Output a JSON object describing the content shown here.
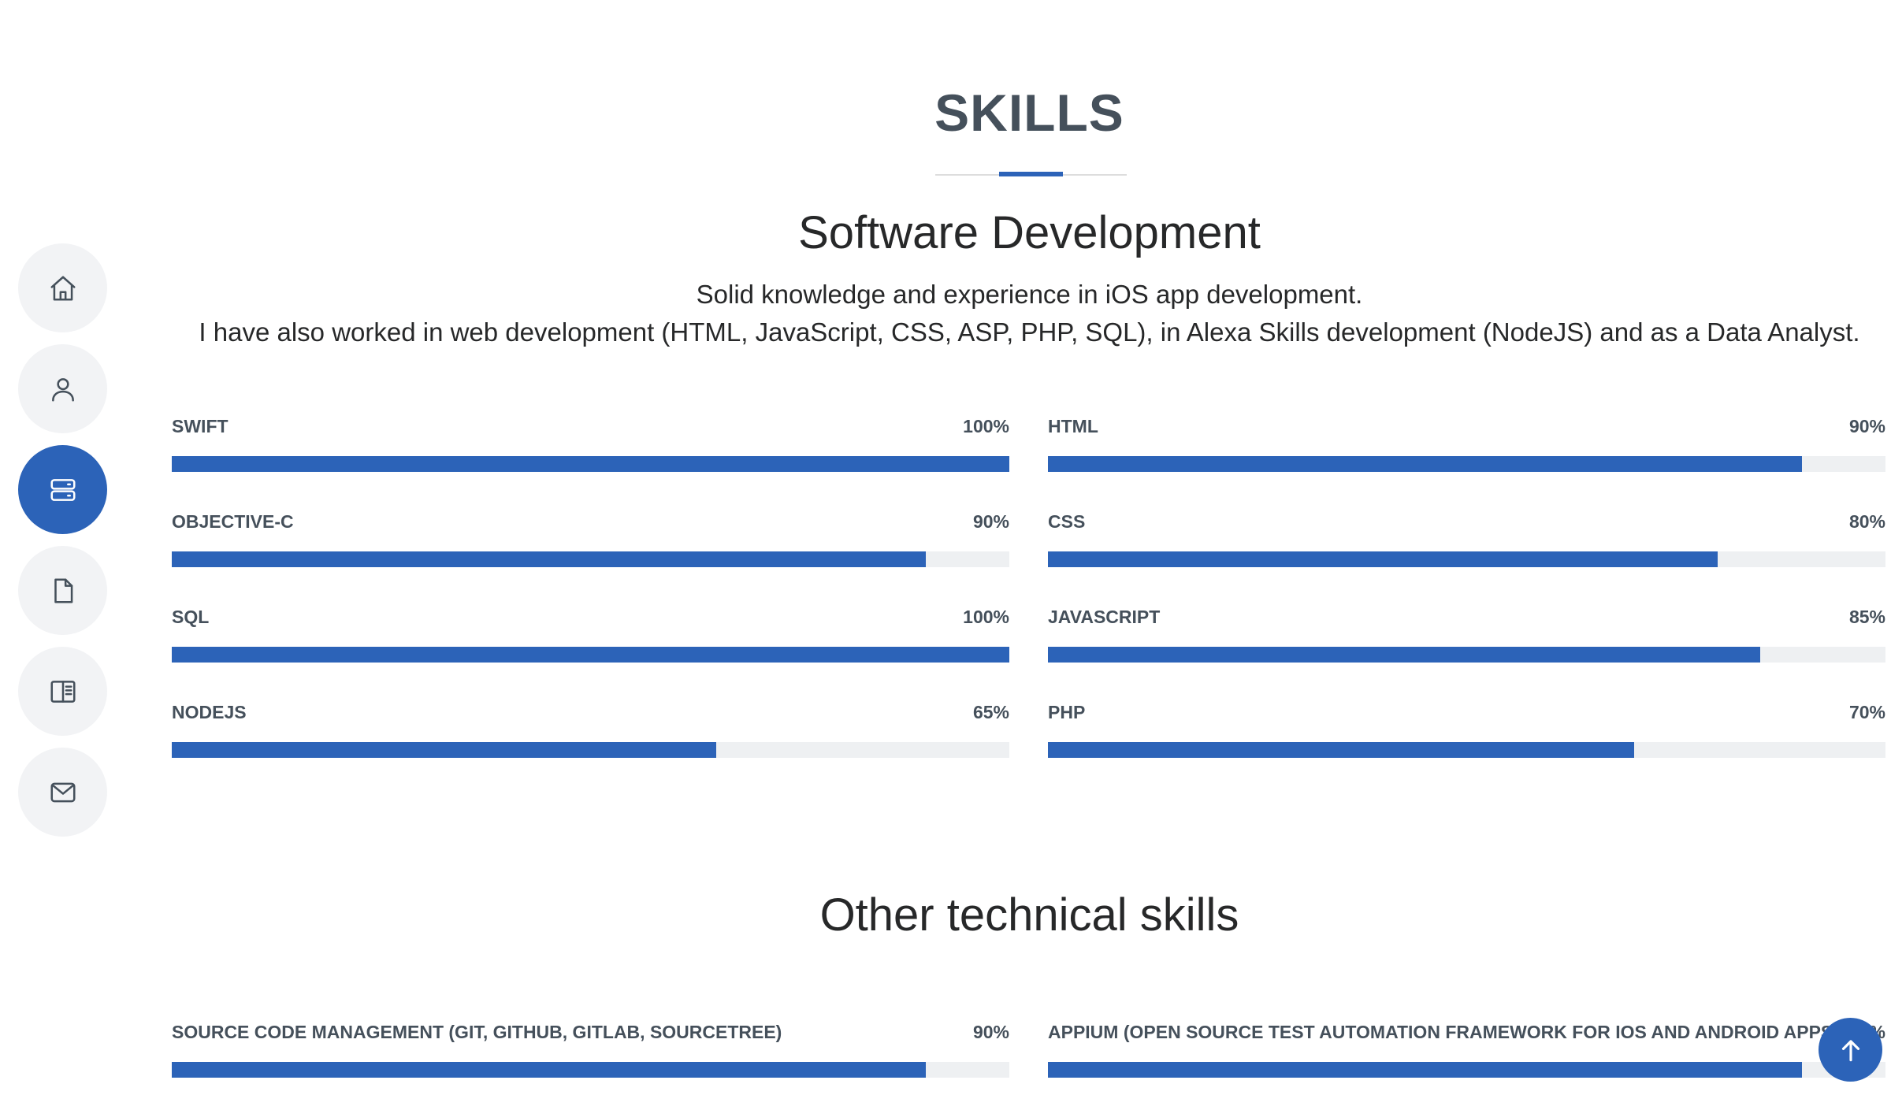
{
  "nav": [
    {
      "name": "home",
      "icon": "home-icon",
      "active": false
    },
    {
      "name": "about",
      "icon": "person-icon",
      "active": false
    },
    {
      "name": "skills",
      "icon": "server-icon",
      "active": true
    },
    {
      "name": "resume",
      "icon": "file-icon",
      "active": false
    },
    {
      "name": "portfolio",
      "icon": "book-icon",
      "active": false
    },
    {
      "name": "contact",
      "icon": "envelope-icon",
      "active": false
    }
  ],
  "section": {
    "title": "SKILLS"
  },
  "software": {
    "heading": "Software Development",
    "line1": "Solid knowledge and experience in iOS app development.",
    "line2": "I have also worked in web development (HTML, JavaScript, CSS, ASP, PHP, SQL), in Alexa Skills development (NodeJS) and as a Data Analyst.",
    "left": [
      {
        "name": "SWIFT",
        "pct": "100%",
        "value": 100
      },
      {
        "name": "OBJECTIVE-C",
        "pct": "90%",
        "value": 90
      },
      {
        "name": "SQL",
        "pct": "100%",
        "value": 100
      },
      {
        "name": "NODEJS",
        "pct": "65%",
        "value": 65
      }
    ],
    "right": [
      {
        "name": "HTML",
        "pct": "90%",
        "value": 90
      },
      {
        "name": "CSS",
        "pct": "80%",
        "value": 80
      },
      {
        "name": "JAVASCRIPT",
        "pct": "85%",
        "value": 85
      },
      {
        "name": "PHP",
        "pct": "70%",
        "value": 70
      }
    ]
  },
  "other": {
    "heading": "Other technical skills",
    "left": [
      {
        "name": "SOURCE CODE MANAGEMENT (GIT, GITHUB, GITLAB, SOURCETREE)",
        "pct": "90%",
        "value": 90
      }
    ],
    "right": [
      {
        "name": "APPIUM (OPEN SOURCE TEST AUTOMATION FRAMEWORK FOR IOS AND ANDROID APPS)",
        "pct": "90%",
        "value": 90
      }
    ]
  },
  "colors": {
    "accent": "#2c63b8",
    "text": "#45505b",
    "track": "#eef0f2"
  },
  "back_to_top": {
    "icon": "arrow-up-icon"
  }
}
